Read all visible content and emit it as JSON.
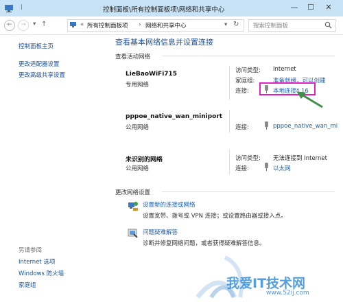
{
  "window": {
    "title": "控制面板\\所有控制面板项\\网络和共享中心",
    "controls": {
      "minimize": "—",
      "maximize": "☐",
      "close": "✕"
    }
  },
  "nav": {
    "back": "←",
    "forward": "→",
    "dropdown": "▾",
    "up": "↑",
    "breadcrumb_prefix": "«",
    "breadcrumb_1": "所有控制面板项",
    "breadcrumb_sep": "›",
    "breadcrumb_2": "网络和共享中心",
    "refresh": "↻",
    "search_placeholder": "搜索控制面板"
  },
  "sidebar": {
    "items": [
      "控制面板主页",
      "更改适配器设置",
      "更改高级共享设置"
    ],
    "see_also_heading": "另请参阅",
    "see_also": [
      "Internet 选项",
      "Windows 防火墙",
      "家庭组"
    ]
  },
  "main": {
    "heading": "查看基本网络信息并设置连接",
    "active_section": "查看活动网络",
    "labels": {
      "access": "访问类型:",
      "homegroup": "家庭组:",
      "connection": "连接:"
    },
    "networks": [
      {
        "name": "LieBaoWiFi715",
        "type": "专用网络",
        "access": "Internet",
        "homegroup": "准备就绪，可以创建",
        "connection": "本地连接* 16"
      },
      {
        "name": "pppoe_native_wan_miniport",
        "type": "公用网络",
        "connection": "pppoe_native_wan_mi"
      },
      {
        "name": "未识别的网络",
        "type": "公用网络",
        "access": "无法连接到 Internet",
        "connection": "以太网"
      }
    ],
    "change_section": "更改网络设置",
    "tasks": [
      {
        "title": "设置新的连接或网络",
        "desc": "设置宽带、拨号或 VPN 连接；或设置路由器或接入点。"
      },
      {
        "title": "问题疑难解答",
        "desc": "诊断并修复网络问题，或者获得疑难解答信息。"
      }
    ]
  },
  "watermark": {
    "text": "我爱IT技术网",
    "url": "www.52ij.com"
  },
  "colors": {
    "highlight_box": "#e020c8",
    "arrow": "#3f8f48",
    "link": "#1a5fb4"
  }
}
